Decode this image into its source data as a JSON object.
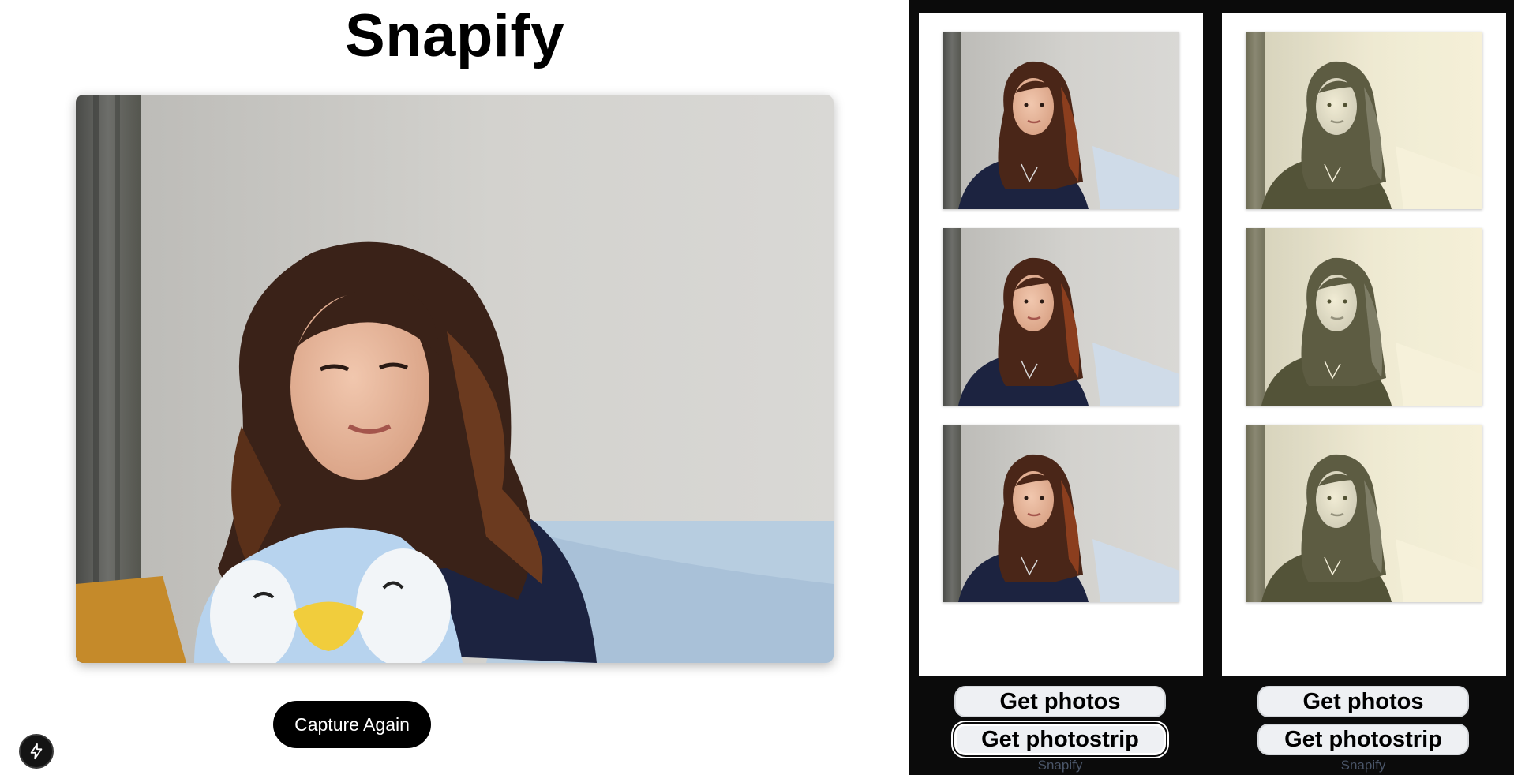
{
  "app": {
    "title": "Snapify"
  },
  "camera": {
    "capture_label": "Capture Again"
  },
  "strips": [
    {
      "filter": "color",
      "photos": [
        "photo-1",
        "photo-2",
        "photo-3"
      ],
      "get_photos_label": "Get photos",
      "get_photostrip_label": "Get photostrip",
      "caption": "Snapify"
    },
    {
      "filter": "sepia-bw",
      "photos": [
        "photo-1",
        "photo-2",
        "photo-3"
      ],
      "get_photos_label": "Get photos",
      "get_photostrip_label": "Get photostrip",
      "caption": "Snapify"
    }
  ],
  "dev_indicator": {
    "icon": "lightning-bolt-icon"
  },
  "colors": {
    "button_bg": "#000000",
    "button_text": "#ffffff",
    "strip_bg": "#0b0b0b",
    "strip_paper": "#ffffff",
    "strip_button": "#eef0f3",
    "caption": "#4a5568"
  }
}
